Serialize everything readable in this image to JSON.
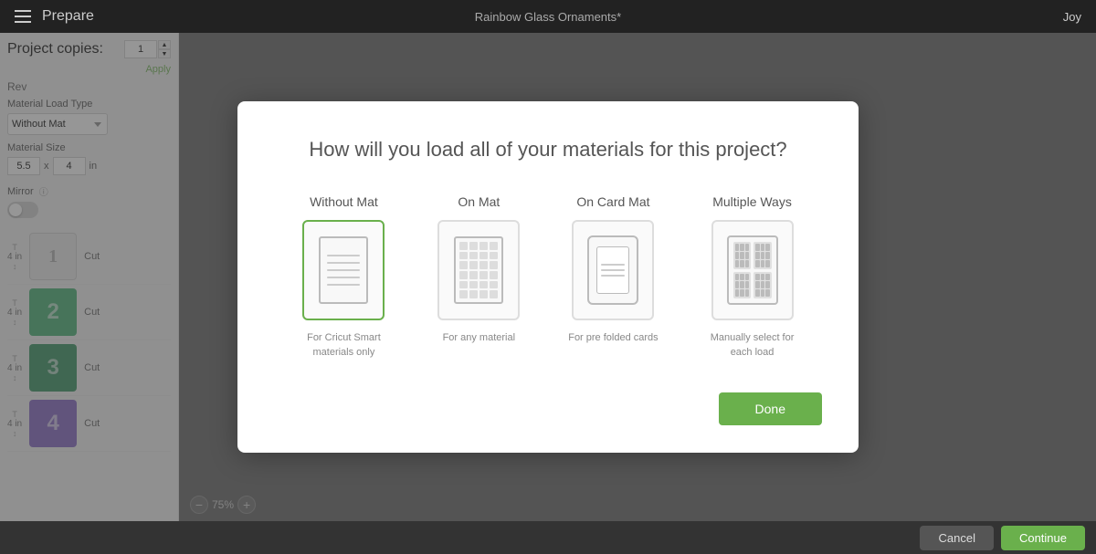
{
  "topBar": {
    "menuIcon": "hamburger-icon",
    "prepareLabel": "Prepare",
    "projectTitle": "Rainbow Glass Ornaments*",
    "userLabel": "Joy"
  },
  "leftPanel": {
    "projectCopiesLabel": "Project copies:",
    "copiesValue": "1",
    "applyLabel": "Apply",
    "revLabel": "Rev",
    "materialLoadTypeLabel": "Material Load Type",
    "materialLoadTypeValue": "Without Mat",
    "materialSizeLabel": "Material Size",
    "sizeWidth": "5.5",
    "sizeCross": "x",
    "sizeHeight": "4",
    "sizeUnit": "in",
    "mirrorLabel": "Mirror",
    "matItems": [
      {
        "size": "4 in",
        "label": "1",
        "cut": "Cut",
        "color": "#d0d0d0",
        "isFirst": true
      },
      {
        "size": "4 in",
        "label": "2",
        "cut": "Cut",
        "color": "#3aaa6a"
      },
      {
        "size": "4 in",
        "label": "3",
        "cut": "Cut",
        "color": "#2a8a55"
      },
      {
        "size": "4 in",
        "label": "4",
        "cut": "Cut",
        "color": "#7a5abf"
      }
    ]
  },
  "modal": {
    "title": "How will you load all of your materials for this project?",
    "options": [
      {
        "id": "without-mat",
        "label": "Without Mat",
        "description": "For Cricut Smart materials only",
        "selected": true
      },
      {
        "id": "on-mat",
        "label": "On Mat",
        "description": "For any material",
        "selected": false
      },
      {
        "id": "on-card-mat",
        "label": "On Card Mat",
        "description": "For pre folded cards",
        "selected": false
      },
      {
        "id": "multiple-ways",
        "label": "Multiple Ways",
        "description": "Manually select for each load",
        "selected": false
      }
    ],
    "doneLabel": "Done"
  },
  "bottomBar": {
    "cancelLabel": "Cancel",
    "continueLabel": "Continue"
  },
  "zoom": {
    "level": "75%"
  }
}
